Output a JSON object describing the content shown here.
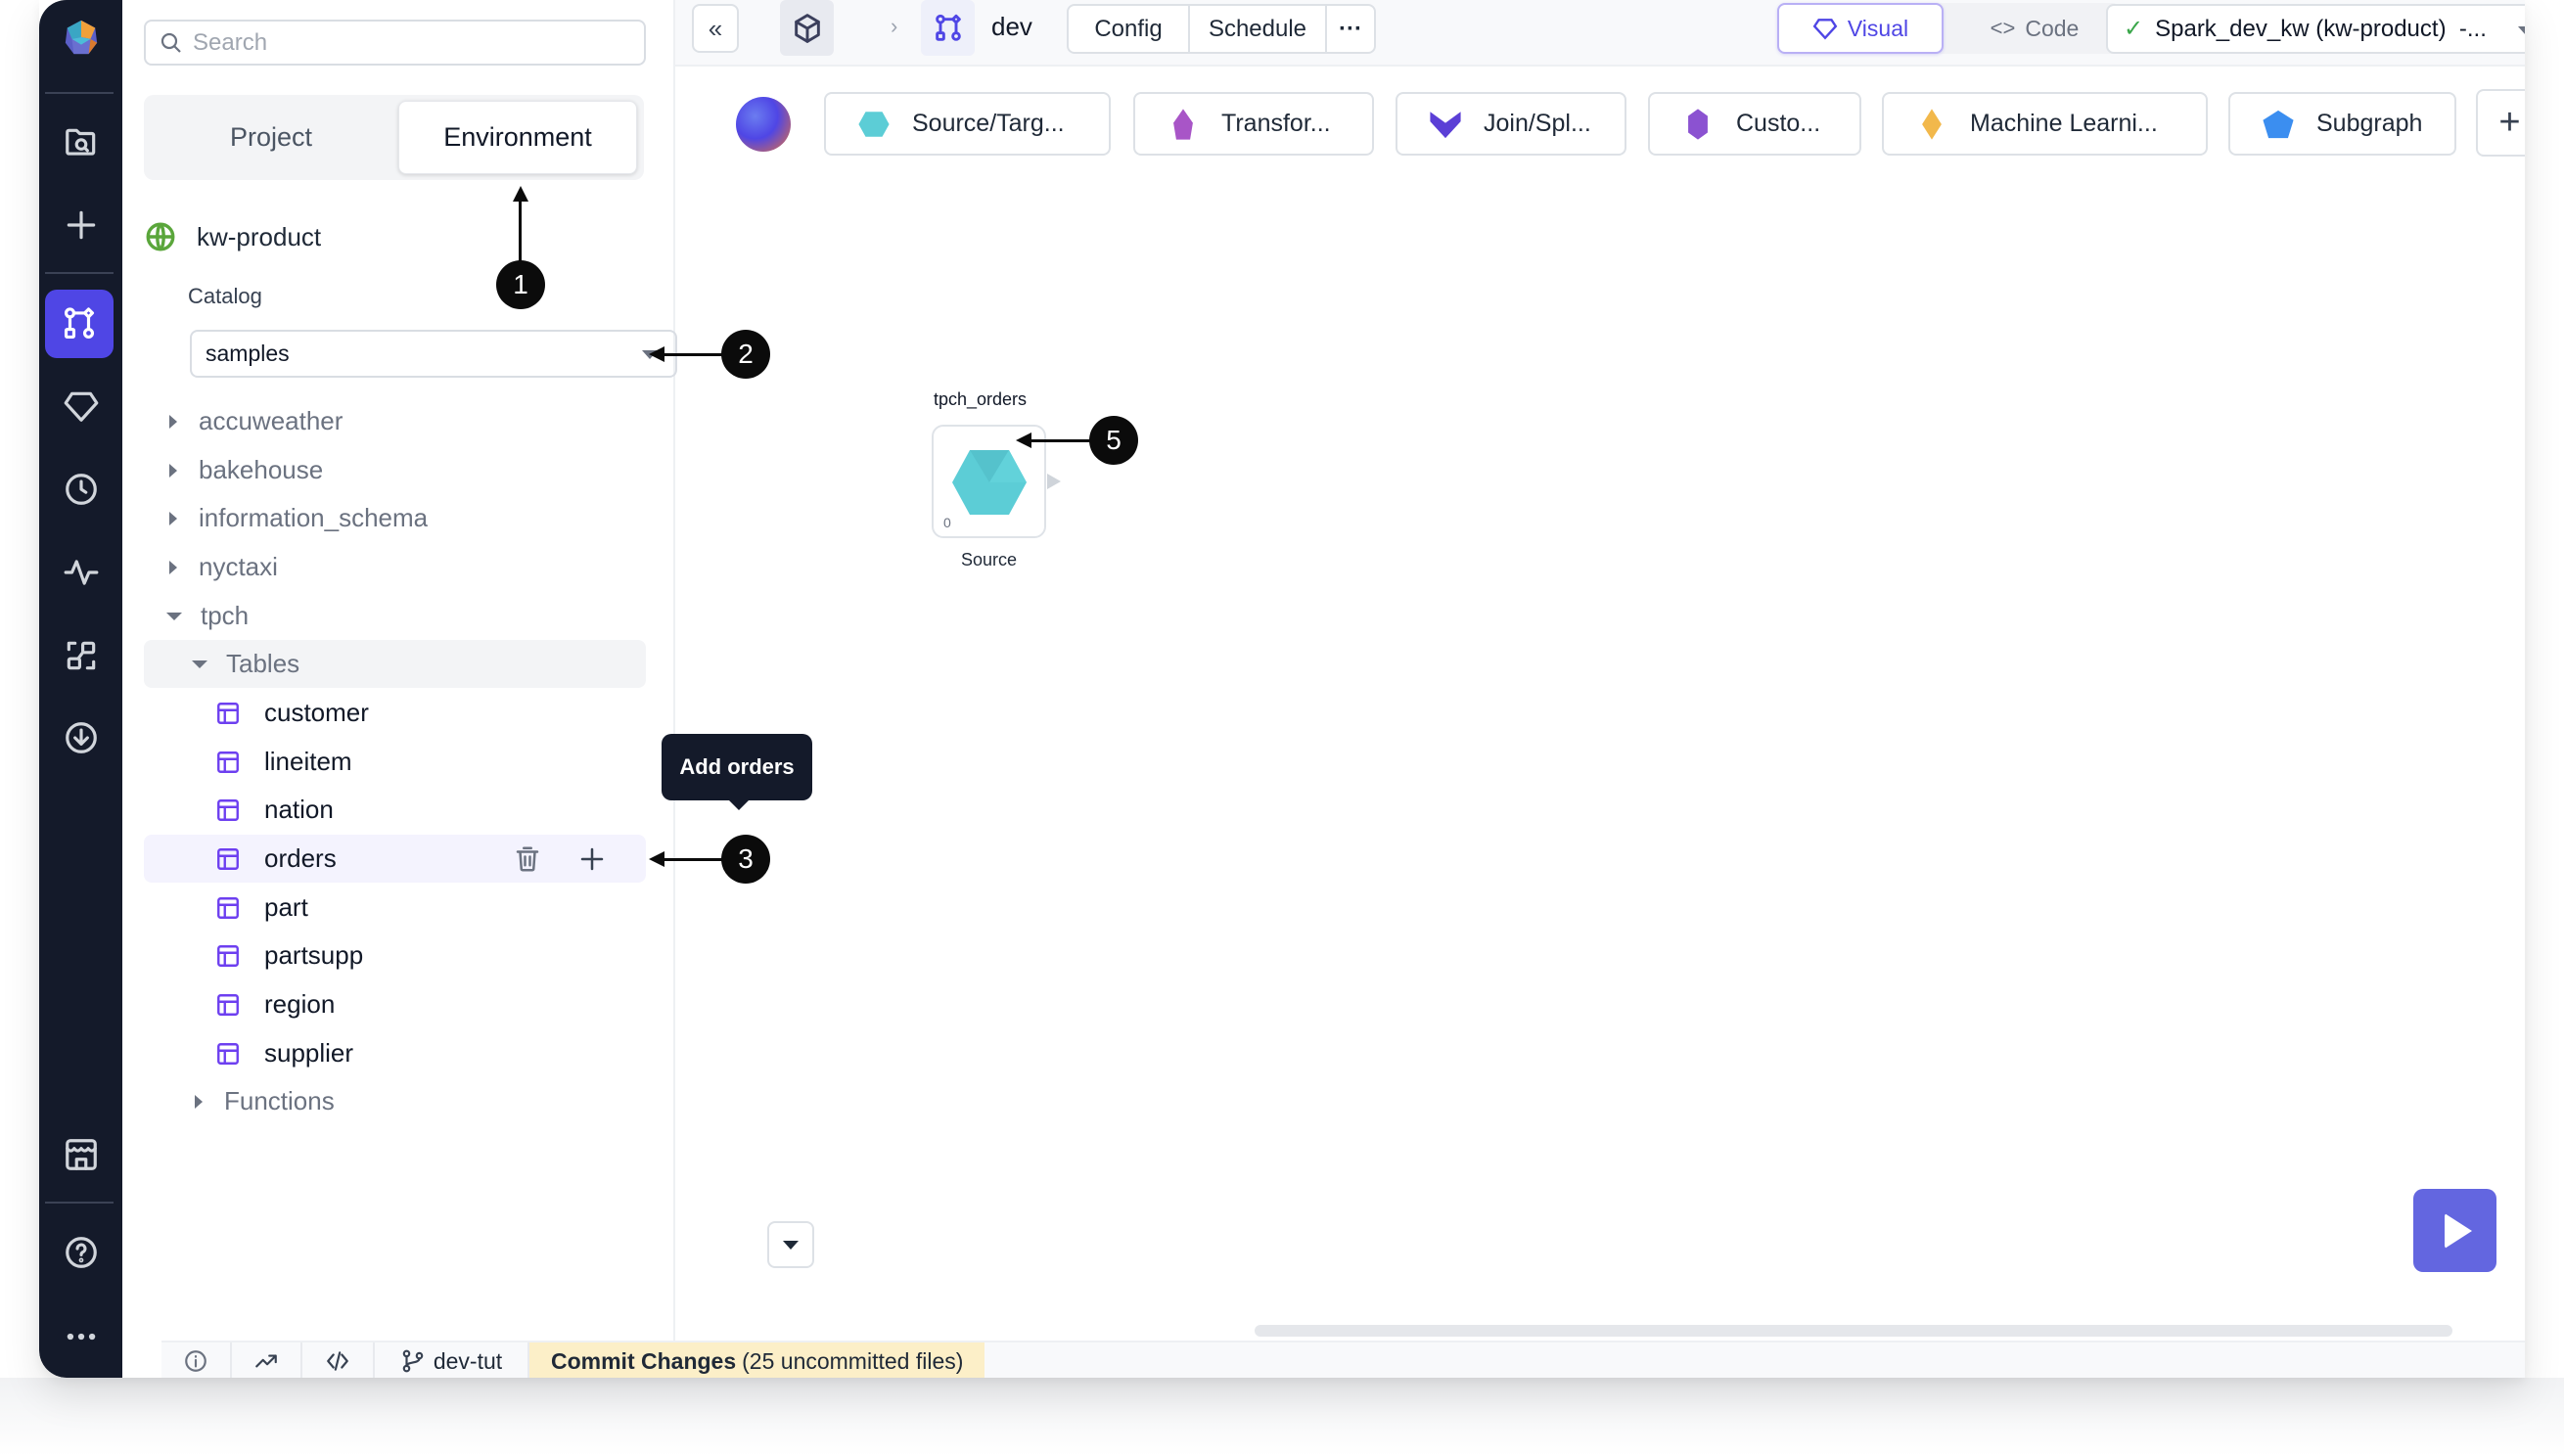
{
  "rail": {
    "icons": [
      "prophecy-logo",
      "browse-folder-icon",
      "create-plus-icon",
      "pipeline-graph-icon",
      "gem-icon",
      "schedule-clock-icon",
      "observability-pulse-icon",
      "lineage-icon",
      "download-circle-icon",
      "marketplace-store-icon",
      "help-icon",
      "more-icon"
    ],
    "active": "pipeline-graph-icon"
  },
  "sidebar": {
    "search": {
      "placeholder": "Search",
      "value": ""
    },
    "tabs": [
      {
        "label": "Project",
        "active": false
      },
      {
        "label": "Environment",
        "active": true
      }
    ],
    "environment": {
      "name": "kw-product",
      "icon": "globe-icon"
    },
    "catalog": {
      "label": "Catalog",
      "selected": "samples"
    },
    "tree": {
      "schemas": [
        {
          "label": "accuweather",
          "expanded": false
        },
        {
          "label": "bakehouse",
          "expanded": false
        },
        {
          "label": "information_schema",
          "expanded": false
        },
        {
          "label": "nyctaxi",
          "expanded": false
        },
        {
          "label": "tpch",
          "expanded": true
        }
      ],
      "tables_folder": {
        "label": "Tables",
        "expanded": true
      },
      "tables": [
        "customer",
        "lineitem",
        "nation",
        "orders",
        "part",
        "partsupp",
        "region",
        "supplier"
      ],
      "hovered_table": "orders",
      "functions_folder": {
        "label": "Functions",
        "expanded": false
      }
    },
    "tooltip": "Add orders"
  },
  "topbar": {
    "collapse_label": "«",
    "breadcrumb_sep": "›",
    "pipeline_name": "dev",
    "buttons": [
      "Config",
      "Schedule",
      "···"
    ],
    "view_toggle": {
      "visual": "Visual",
      "code": "Code",
      "active": "Visual"
    },
    "cluster": {
      "label": "Spark_dev_kw (kw-product)  -...",
      "status": "connected"
    }
  },
  "gems": [
    {
      "label": "Source/Targ...",
      "color": "#5ccdd6"
    },
    {
      "label": "Transfor...",
      "color": "#a855c7"
    },
    {
      "label": "Join/Spl...",
      "color": "#5b3fd6"
    },
    {
      "label": "Custo...",
      "color": "#8b52d1"
    },
    {
      "label": "Machine Learni...",
      "color": "#f2b84b"
    },
    {
      "label": "Subgraph",
      "color": "#3b8ef0"
    }
  ],
  "gem_add_label": "+",
  "canvas": {
    "node": {
      "title": "tpch_orders",
      "type": "Source",
      "count": "0",
      "color": "#5ccdd6"
    }
  },
  "callouts": [
    "1",
    "2",
    "3",
    "5"
  ],
  "status_bar": {
    "branch": "dev-tut",
    "commit_label": "Commit Changes",
    "commit_detail": "(25 uncommitted files)"
  },
  "colors": {
    "accent": "#4f46e5",
    "rail": "#141a2a",
    "commit_bg": "#fcefc8",
    "commit_text": "#b45a1f"
  }
}
